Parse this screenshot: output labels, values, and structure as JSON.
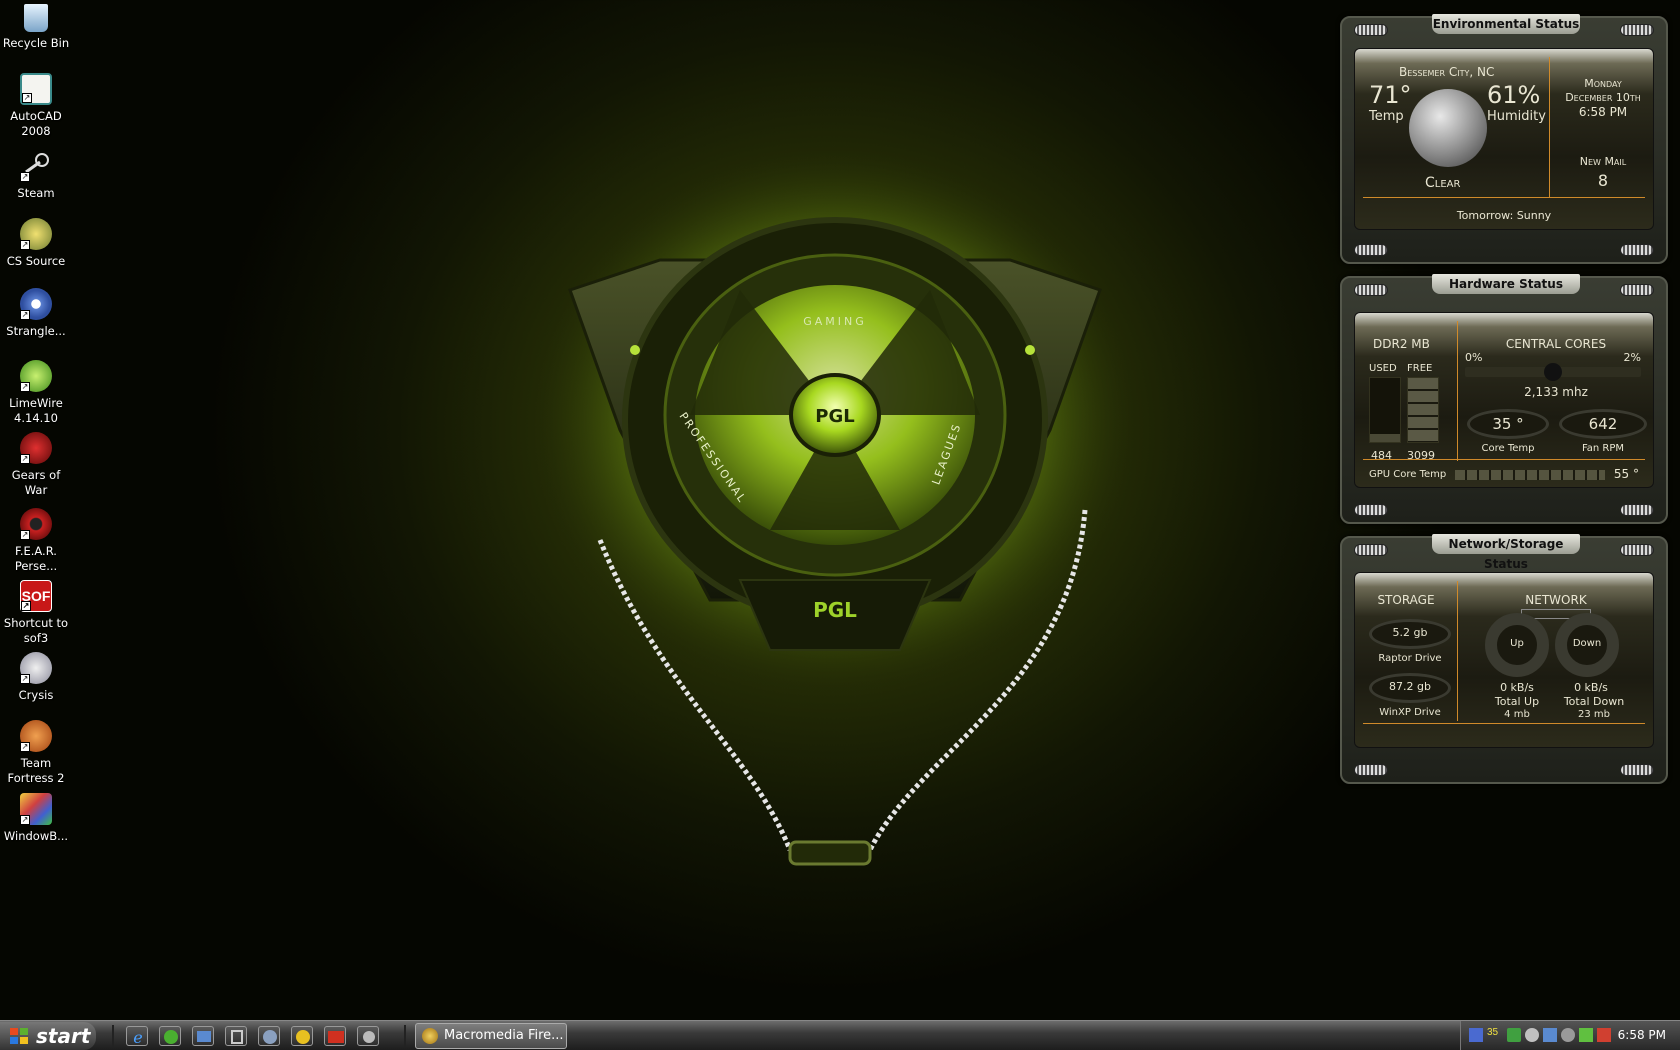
{
  "desktop_icons": [
    {
      "label": "Recycle Bin",
      "icon": "recycle-bin-icon"
    },
    {
      "label": "AutoCAD 2008",
      "icon": "autocad-icon"
    },
    {
      "label": "Steam",
      "icon": "steam-icon"
    },
    {
      "label": "CS  Source",
      "icon": "cs-source-icon"
    },
    {
      "label": "Strangle...",
      "icon": "strangle-icon"
    },
    {
      "label": "LimeWire 4.14.10",
      "icon": "limewire-icon"
    },
    {
      "label": "Gears of War",
      "icon": "gears-of-war-icon"
    },
    {
      "label": "F.E.A.R. Perse...",
      "icon": "fear-icon"
    },
    {
      "label": "Shortcut to sof3",
      "icon": "sof3-icon"
    },
    {
      "label": "Crysis",
      "icon": "crysis-icon"
    },
    {
      "label": "Team Fortress 2",
      "icon": "team-fortress-icon"
    },
    {
      "label": "WindowB...",
      "icon": "windowblinds-icon"
    }
  ],
  "wallpaper": {
    "top_arc_text": "GAMING",
    "left_arc_text": "PROFESSIONAL",
    "right_arc_text": "LEAGUES",
    "center_logo": "PGL",
    "lower_logo": "PGL"
  },
  "env_gadget": {
    "title": "Environmental Status",
    "city": "Bessemer City, NC",
    "temp": "71°",
    "temp_label": "Temp",
    "humidity": "61%",
    "humidity_label": "Humidity",
    "condition": "Clear",
    "day": "Monday",
    "date": "December 10th",
    "time": "6:58 PM",
    "mail_label": "New Mail",
    "mail_count": "8",
    "tomorrow": "Tomorrow: Sunny"
  },
  "hw_gadget": {
    "title": "Hardware Status",
    "mem_label": "DDR2 MB",
    "used_label": "USED",
    "free_label": "FREE",
    "used_value": "484",
    "free_value": "3099",
    "cpu_label": "CENTRAL CORES",
    "core0": "0%",
    "core1": "2%",
    "cpu_speed": "2,133 mhz",
    "core_temp": "35 °",
    "core_temp_label": "Core Temp",
    "fan_rpm": "642",
    "fan_rpm_label": "Fan RPM",
    "gpu_label": "GPU Core Temp",
    "gpu_temp": "55 °"
  },
  "net_gadget": {
    "title": "Network/Storage Status",
    "storage_label": "STORAGE",
    "network_label": "NETWORK",
    "drive1_size": "5.2 gb",
    "drive1_name": "Raptor Drive",
    "drive2_size": "87.2 gb",
    "drive2_name": "WinXP Drive",
    "up_label": "Up",
    "down_label": "Down",
    "up_rate": "0 kB/s",
    "down_rate": "0 kB/s",
    "total_up_label": "Total Up",
    "total_down_label": "Total Down",
    "total_up": "4 mb",
    "total_down": "23 mb"
  },
  "taskbar": {
    "start_label": "start",
    "quick_launch": [
      "ie-icon",
      "utorrent-icon",
      "desktop-icon",
      "app-icon",
      "s-icon",
      "aim-icon",
      "aim2-icon",
      "settings-icon"
    ],
    "task_label": "Macromedia Fire...",
    "clock": "6:58 PM",
    "tray_text": "35"
  },
  "colors": {
    "accent": "#b6e23a",
    "gadget_text": "#e9e6d2",
    "orange_line": "#d08a2a"
  }
}
